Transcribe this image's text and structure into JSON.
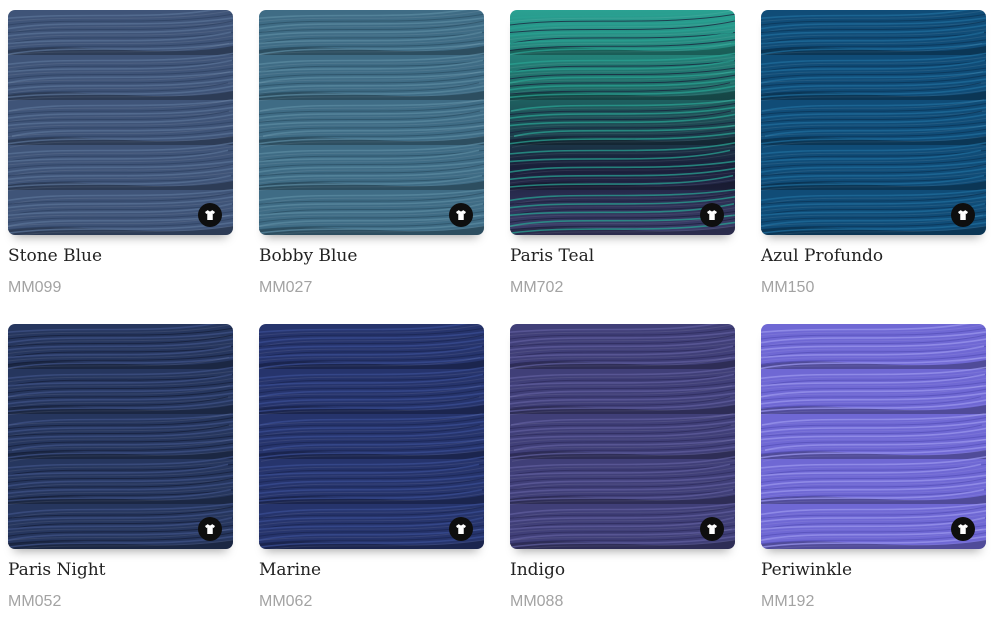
{
  "colors": [
    {
      "name": "Stone Blue",
      "code": "MM099",
      "tones": [
        "#3f5478",
        "#5a7196",
        "#2f4262"
      ],
      "icon": "shirt-icon"
    },
    {
      "name": "Bobby Blue",
      "code": "MM027",
      "tones": [
        "#3f6c85",
        "#5b8aa0",
        "#2c5066"
      ],
      "icon": "shirt-icon"
    },
    {
      "name": "Paris Teal",
      "code": "MM702",
      "tones": [
        "#1f6a66",
        "#2aa192",
        "#1a1f3a",
        "#3d3f6c"
      ],
      "icon": "shirt-icon"
    },
    {
      "name": "Azul Profundo",
      "code": "MM150",
      "tones": [
        "#104c77",
        "#1f6c9b",
        "#0b3455"
      ],
      "icon": "shirt-icon"
    },
    {
      "name": "Paris Night",
      "code": "MM052",
      "tones": [
        "#26365e",
        "#3f5285",
        "#151f3a"
      ],
      "icon": "shirt-icon"
    },
    {
      "name": "Marine",
      "code": "MM062",
      "tones": [
        "#26346c",
        "#3a4c92",
        "#1b2552"
      ],
      "icon": "shirt-icon"
    },
    {
      "name": "Indigo",
      "code": "MM088",
      "tones": [
        "#403f78",
        "#5f5e9c",
        "#2e2c5c"
      ],
      "icon": "shirt-icon"
    },
    {
      "name": "Periwinkle",
      "code": "MM192",
      "tones": [
        "#6f68d4",
        "#9a95ec",
        "#5650b8"
      ],
      "icon": "shirt-icon"
    }
  ]
}
